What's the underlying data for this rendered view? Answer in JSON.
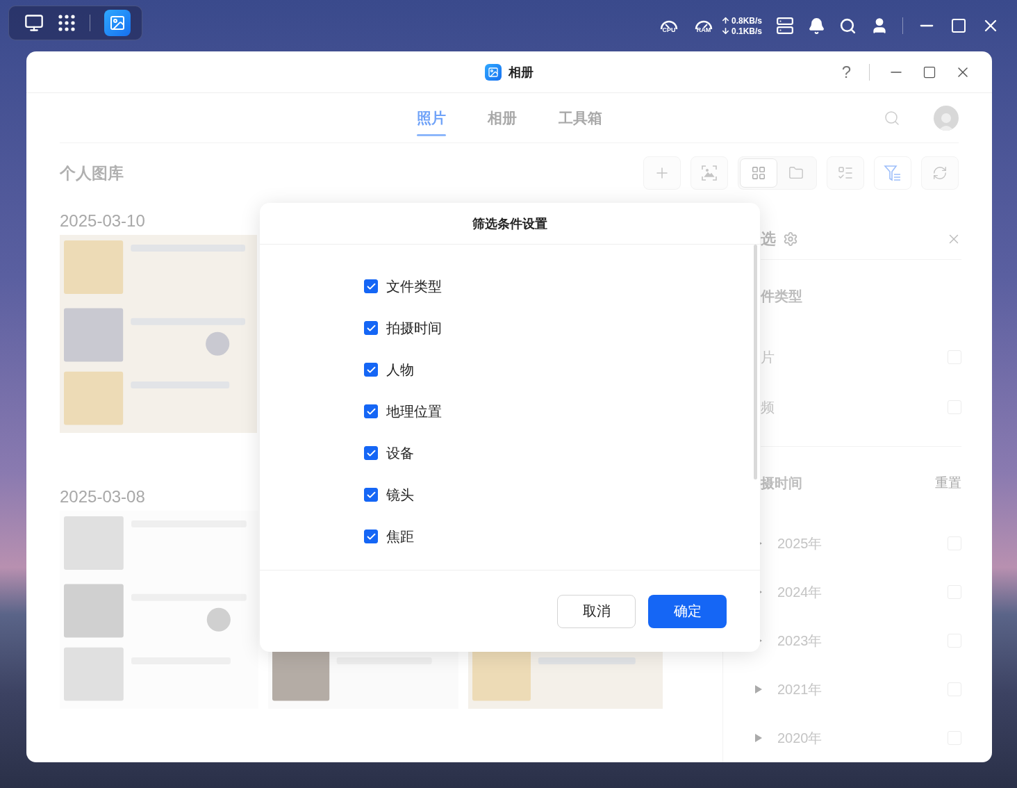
{
  "taskbar": {
    "cpu_label": "CPU",
    "ram_label": "RAM",
    "upload": "0.8KB/s",
    "download": "0.1KB/s"
  },
  "window": {
    "title": "相册",
    "help": "?"
  },
  "tabs": [
    {
      "label": "照片",
      "selected": true
    },
    {
      "label": "相册",
      "selected": false
    },
    {
      "label": "工具箱",
      "selected": false
    }
  ],
  "library": {
    "title": "个人图库",
    "view_modes": [
      {
        "kind": "grid",
        "selected": true
      },
      {
        "kind": "folder",
        "selected": false
      }
    ],
    "filter_active": true
  },
  "gallery": [
    {
      "date": "2025-03-10"
    },
    {
      "date": "2025-03-08"
    }
  ],
  "filter_panel": {
    "title": "选",
    "sections": [
      {
        "title": "件类型",
        "items": [
          {
            "label": "片",
            "checked": false
          },
          {
            "label": "频",
            "checked": false
          }
        ]
      },
      {
        "title": "摄时间",
        "reset": "重置",
        "items": [
          {
            "label": "2025年",
            "checked": false,
            "expanded": false
          },
          {
            "label": "2024年",
            "checked": false,
            "expanded": false
          },
          {
            "label": "2023年",
            "checked": false,
            "expanded": false
          },
          {
            "label": "2021年",
            "checked": false,
            "expanded": false
          },
          {
            "label": "2020年",
            "checked": false,
            "expanded": false
          }
        ]
      }
    ]
  },
  "dialog": {
    "title": "筛选条件设置",
    "options": [
      {
        "label": "文件类型",
        "checked": true
      },
      {
        "label": "拍摄时间",
        "checked": true
      },
      {
        "label": "人物",
        "checked": true
      },
      {
        "label": "地理位置",
        "checked": true
      },
      {
        "label": "设备",
        "checked": true
      },
      {
        "label": "镜头",
        "checked": true
      },
      {
        "label": "焦距",
        "checked": true
      }
    ],
    "buttons": [
      {
        "label": "取消",
        "kind": "secondary"
      },
      {
        "label": "确定",
        "kind": "primary"
      }
    ]
  }
}
